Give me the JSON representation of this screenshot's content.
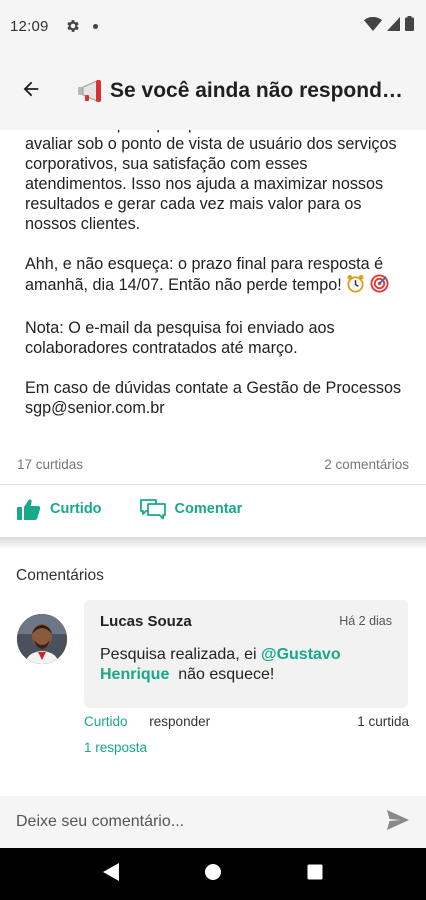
{
  "status_bar": {
    "time": "12:09"
  },
  "header": {
    "title": "Se você ainda não respondeu a pesquisa de satisfação",
    "title_icon": "megaphone-icon",
    "back_icon": "arrow-left-icon"
  },
  "post": {
    "paragraphs": [
      "Lembrando que a pesquisa é anônima e busca avaliar sob o ponto de vista de usuário dos serviços corporativos, sua satisfação com esses atendimentos. Isso nos ajuda a maximizar nossos resultados e gerar cada vez mais valor para os nossos clientes.",
      "Ahh, e não esqueça: o prazo final para resposta é amanhã, dia 14/07. Então não perde tempo!",
      "Nota: O e-mail da pesquisa foi enviado aos colaboradores contratados até março.",
      "Em caso de dúvidas contate a Gestão de Processos sgp@senior.com.br"
    ],
    "likes_count": "17 curtidas",
    "comments_count": "2 comentários",
    "like_label": "Curtido",
    "comment_label": "Comentar"
  },
  "comments": {
    "heading": "Comentários",
    "items": [
      {
        "author": "Lucas Souza",
        "time": "Há 2 dias",
        "text_before": "Pesquisa realizada, ei ",
        "mention": "@Gustavo Henrique",
        "text_after": "  não esquece!",
        "liked_label": "Curtido",
        "reply_label": "responder",
        "likes": "1 curtida",
        "replies": "1 resposta"
      }
    ]
  },
  "composer": {
    "placeholder": "Deixe seu comentário..."
  },
  "colors": {
    "accent": "#17a98a",
    "app_bar": "#f5f5f6",
    "nav_bar": "#000000"
  }
}
